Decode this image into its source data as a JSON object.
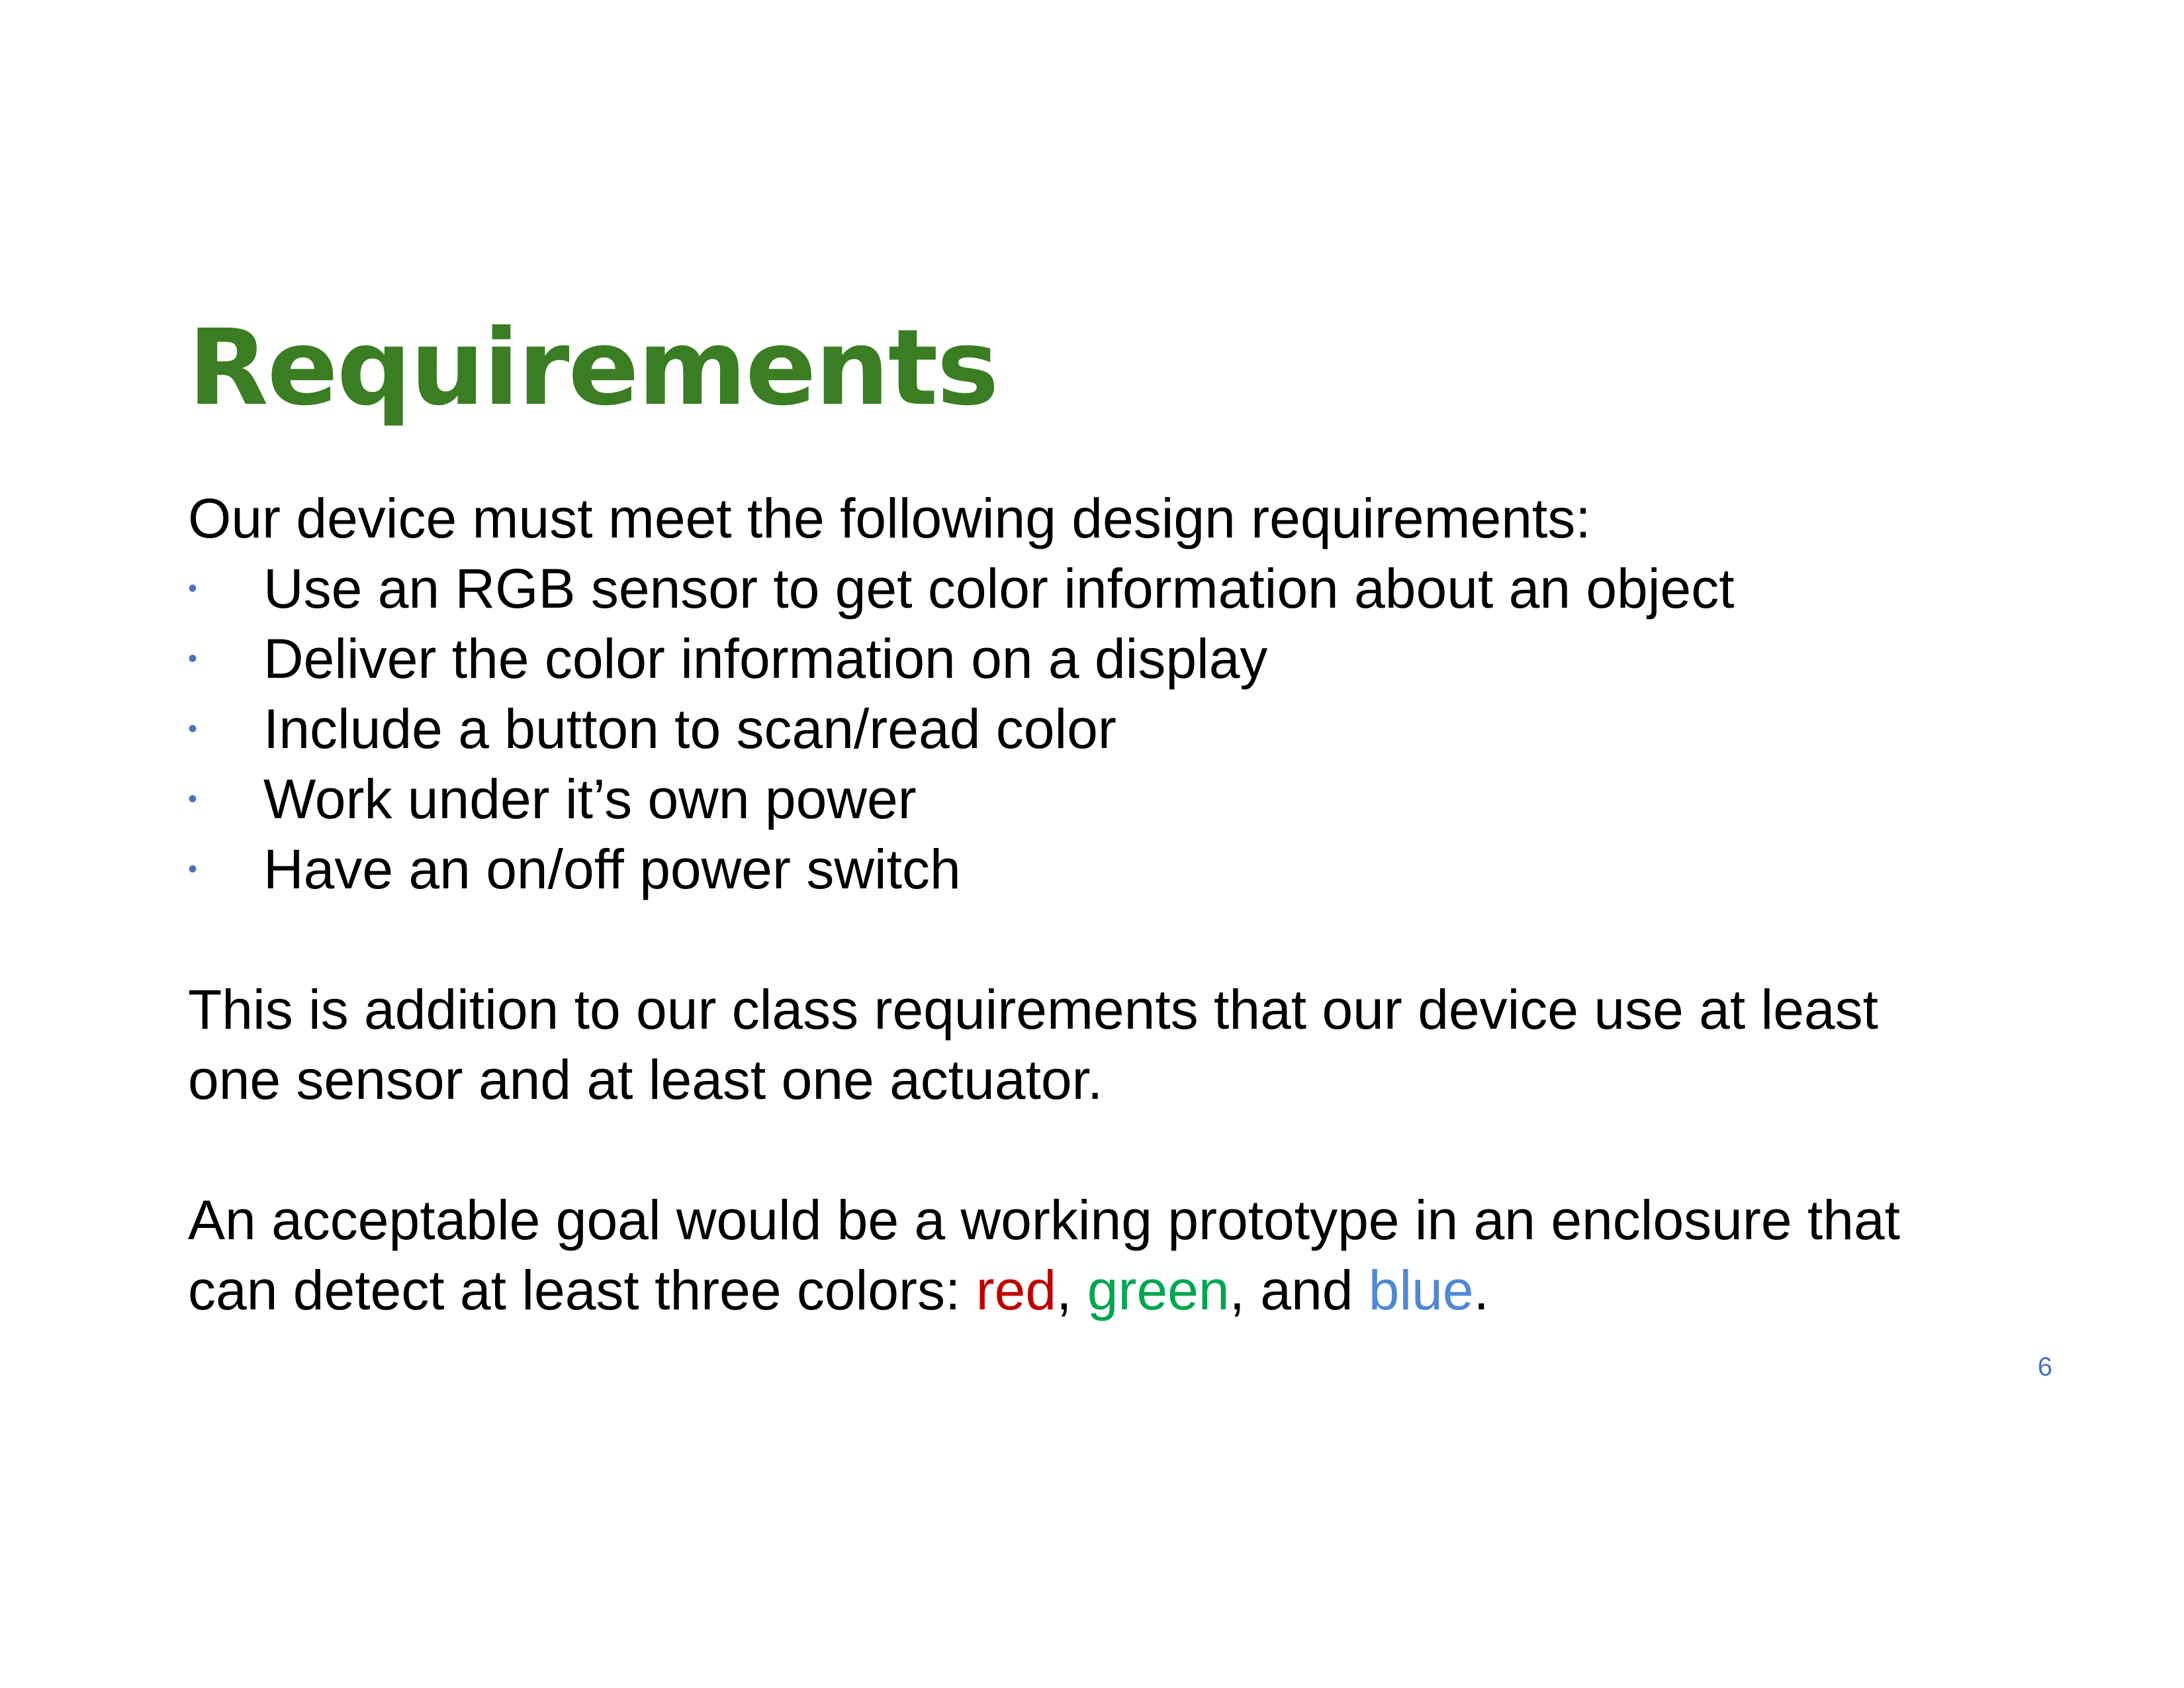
{
  "slide": {
    "title": "Requirements",
    "intro": "Our device must meet the following design requirements:",
    "bullets": [
      "Use an RGB sensor to get color information about an object",
      "Deliver the color information on a display",
      "Include a button to scan/read color",
      "Work under it’s own power",
      "Have an on/off power switch"
    ],
    "bullet_glyph": "•",
    "paragraph1_line1": "This is addition to our class requirements that our device use at least",
    "paragraph1_line2": "one sensor and at least one actuator.",
    "paragraph2_line1": "An acceptable goal would be a working prototype in an enclosure that",
    "paragraph2_line2_prefix": "can detect at least three colors: ",
    "color_red": "red",
    "sep1": ", ",
    "color_green": "green",
    "sep2": ", and ",
    "color_blue": "blue",
    "end_period": ".",
    "page_number": "6"
  },
  "colors": {
    "title": "#3a7d22",
    "bullet": "#4a74b8",
    "red_word": "#c00000",
    "green_word": "#00a651",
    "blue_word": "#4f88d4",
    "page_number": "#4a74b8"
  }
}
